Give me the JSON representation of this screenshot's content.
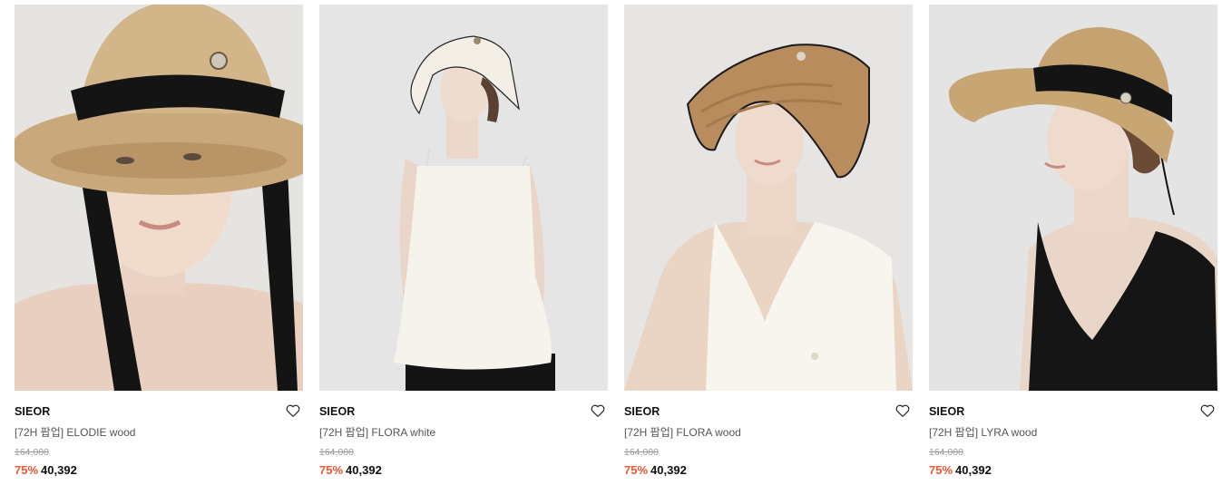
{
  "products": [
    {
      "brand": "SIEOR",
      "name": "[72H 팝업] ELODIE wood",
      "original_price": "164,000",
      "discount": "75%",
      "price": "40,392",
      "image_alt": "ELODIE wood straw hat with black ribbon",
      "wishlist_icon": "heart-icon"
    },
    {
      "brand": "SIEOR",
      "name": "[72H 팝업] FLORA white",
      "original_price": "164,000",
      "discount": "75%",
      "price": "40,392",
      "image_alt": "FLORA white sun visor",
      "wishlist_icon": "heart-icon"
    },
    {
      "brand": "SIEOR",
      "name": "[72H 팝업] FLORA wood",
      "original_price": "164,000",
      "discount": "75%",
      "price": "40,392",
      "image_alt": "FLORA wood straw sun visor",
      "wishlist_icon": "heart-icon"
    },
    {
      "brand": "SIEOR",
      "name": "[72H 팝업] LYRA wood",
      "original_price": "164,000",
      "discount": "75%",
      "price": "40,392",
      "image_alt": "LYRA wood straw hat with black band",
      "wishlist_icon": "heart-icon"
    }
  ],
  "colors": {
    "discount": "#f0562a",
    "photo_background": "#e4e3e2",
    "straw": "#c9a97c",
    "ribbon": "#111111"
  }
}
